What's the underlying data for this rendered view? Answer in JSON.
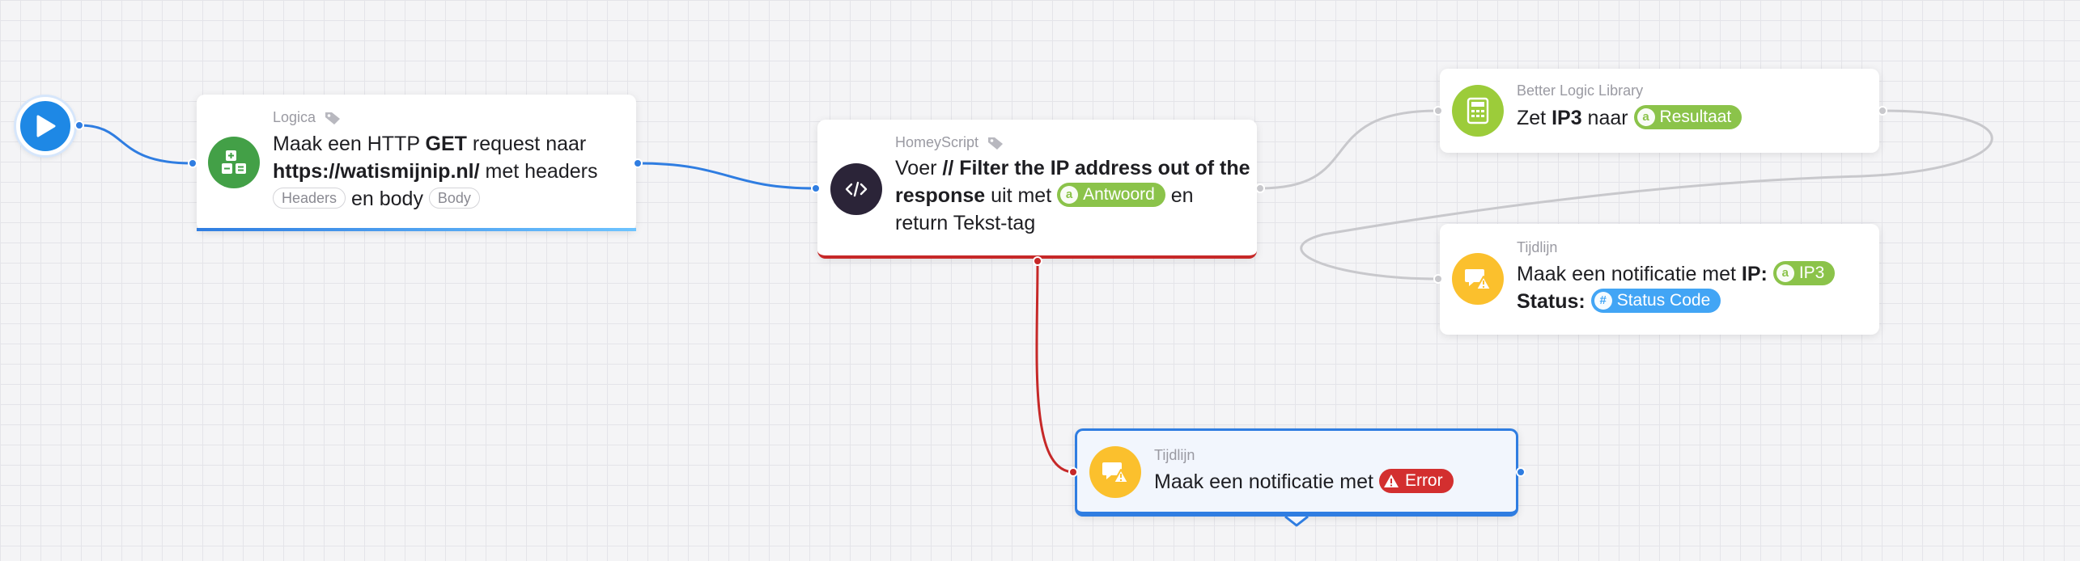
{
  "canvas": {
    "colors": {
      "wire_blue": "#2f7de1",
      "wire_grey": "#c8c8cc",
      "wire_red": "#c62828"
    }
  },
  "start": {
    "icon": "play-icon"
  },
  "nodes": {
    "logica": {
      "label": "Logica",
      "icon": "calculator-icon",
      "color": "#43a047",
      "text_prefix": "Maak een HTTP ",
      "text_method": "GET",
      "text_mid": " request naar",
      "text_url": "https://watismijnip.nl/",
      "text_with_headers": " met headers",
      "headers_chip": "Headers",
      "text_and_body": " en body ",
      "body_chip": "Body"
    },
    "homeyscript": {
      "label": "HomeyScript",
      "icon": "code-icon",
      "color": "#2b2438",
      "text_prefix": "Voer ",
      "text_script": "// Filter the IP address out of the response",
      "text_with": " uit met ",
      "arg_tag": "Antwoord",
      "text_suffix": " en return Tekst-tag"
    },
    "better_logic": {
      "label": "Better Logic Library",
      "icon": "calculator-icon",
      "color": "#9ccc3a",
      "text_prefix": "Zet ",
      "text_var": "IP3",
      "text_mid": " naar ",
      "result_tag": "Resultaat"
    },
    "timeline_ip": {
      "label": "Tijdlijn",
      "icon": "notification-icon",
      "color": "#fbc02d",
      "text_prefix": "Maak een notificatie met ",
      "ip_label": "IP:",
      "ip_tag": "IP3",
      "status_label": "Status:",
      "status_tag": "Status Code"
    },
    "timeline_error": {
      "label": "Tijdlijn",
      "icon": "notification-icon",
      "color": "#fbc02d",
      "text_prefix": "Maak een notificatie met",
      "error_tag": "Error"
    }
  }
}
